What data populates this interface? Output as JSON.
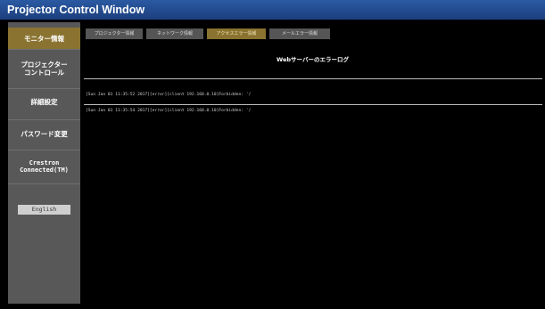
{
  "window": {
    "title": "Projector Control Window"
  },
  "sidebar": {
    "items": [
      {
        "label": "モニター情報"
      },
      {
        "label": "プロジェクター\nコントロール"
      },
      {
        "label": "詳細設定"
      },
      {
        "label": "パスワード変更"
      },
      {
        "label": "Crestron\nConnected(TM)"
      }
    ],
    "language_button": "English"
  },
  "tabs": [
    {
      "label": "プロジェクター情報"
    },
    {
      "label": "ネットワーク情報"
    },
    {
      "label": "アクセスエラー情報"
    },
    {
      "label": "メールエラー情報"
    }
  ],
  "main": {
    "title": "Webサーバーのエラーログ",
    "log_lines": [
      "[Sun Jan 01 11:35:52 2017][error][client 192.168.0.10]Forbidden: '/",
      "[Sun Jan 01 11:35:54 2017][error][client 192.168.0.10]Forbidden: '/"
    ]
  },
  "colors": {
    "accent": "#8a7330",
    "sidebar": "#585858",
    "titlebar": "#1c3f7d"
  }
}
